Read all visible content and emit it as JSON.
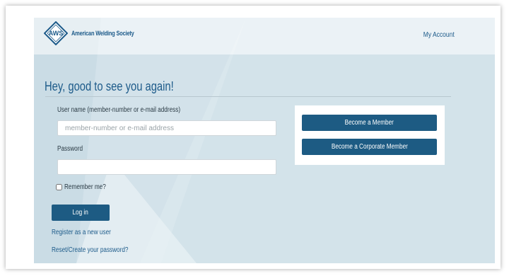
{
  "header": {
    "logo_mark": "AWS",
    "org_name": "American Welding Society",
    "my_account_label": "My Account"
  },
  "login": {
    "greeting": "Hey, good to see you again!",
    "username_label": "User name (member-number or e-mail address)",
    "username_value": "",
    "username_placeholder": "member-number or e-mail address",
    "password_label": "Password",
    "password_value": "",
    "remember_label": "Remember me?",
    "remember_checked": false,
    "login_button": "Log in",
    "register_link": "Register as a new user",
    "reset_link": "Reset/Create your password?"
  },
  "membership": {
    "become_member_button": "Become a Member",
    "become_corporate_button": "Become a Corporate Member"
  },
  "colors": {
    "primary": "#1d5b83",
    "background_tint": "#d3e3ea",
    "link": "#1d5b8a"
  }
}
